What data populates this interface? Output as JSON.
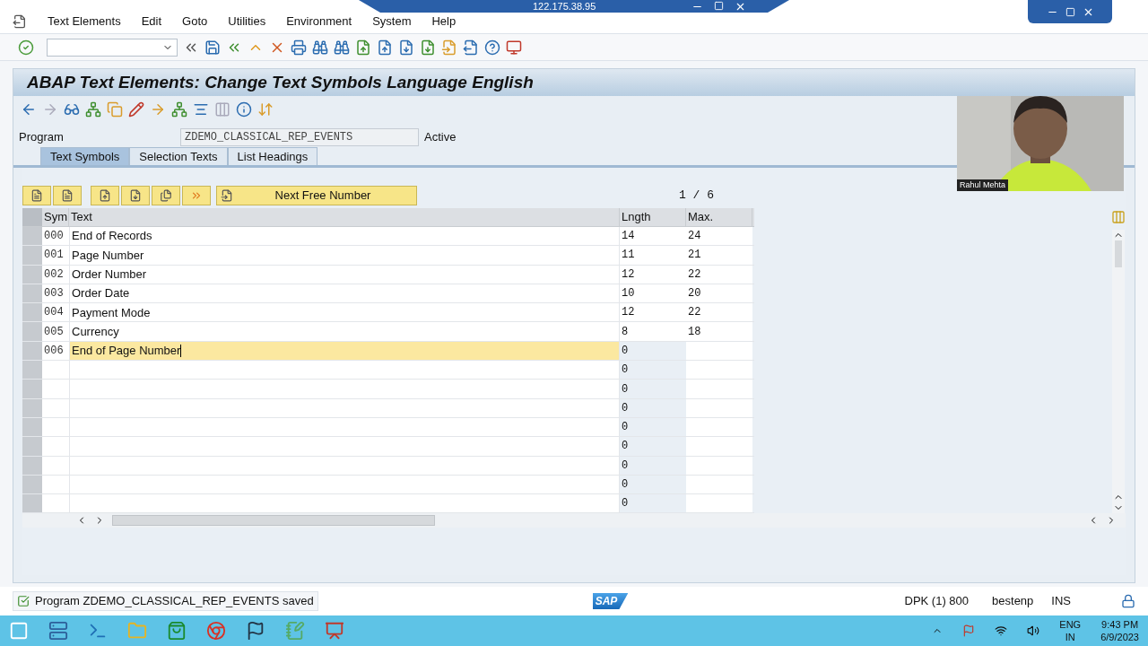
{
  "remote_bar": {
    "address": "122.175.38.95"
  },
  "menu": [
    "Text Elements",
    "Edit",
    "Goto",
    "Utilities",
    "Environment",
    "System",
    "Help"
  ],
  "title": "ABAP Text Elements: Change Text Symbols Language English",
  "program": {
    "label": "Program",
    "value": "ZDEMO_CLASSICAL_REP_EVENTS",
    "status": "Active"
  },
  "tabs": [
    {
      "label": "Text Symbols",
      "selected": true
    },
    {
      "label": "Selection Texts",
      "selected": false
    },
    {
      "label": "List Headings",
      "selected": false
    }
  ],
  "next_button": "Next Free Number",
  "page_count": "1 / 6",
  "table": {
    "columns": [
      "Sym",
      "Text",
      "Lngth",
      "Max."
    ],
    "rows": [
      {
        "sym": "000",
        "text": "End of Records",
        "length": "14",
        "max": "24",
        "editing": false
      },
      {
        "sym": "001",
        "text": "Page Number",
        "length": "11",
        "max": "21",
        "editing": false
      },
      {
        "sym": "002",
        "text": "Order Number",
        "length": "12",
        "max": "22",
        "editing": false
      },
      {
        "sym": "003",
        "text": "Order Date",
        "length": "10",
        "max": "20",
        "editing": false
      },
      {
        "sym": "004",
        "text": "Payment Mode",
        "length": "12",
        "max": "22",
        "editing": false
      },
      {
        "sym": "005",
        "text": "Currency",
        "length": "8",
        "max": "18",
        "editing": false
      },
      {
        "sym": "006",
        "text": "End of Page Number",
        "length": "0",
        "editing": true
      },
      {
        "length": "0",
        "editing": false
      },
      {
        "length": "0",
        "editing": false
      },
      {
        "length": "0",
        "editing": false
      },
      {
        "length": "0",
        "editing": false
      },
      {
        "length": "0",
        "editing": false
      },
      {
        "length": "0",
        "editing": false
      },
      {
        "length": "0",
        "editing": false
      },
      {
        "length": "0",
        "editing": false
      }
    ]
  },
  "webcam": {
    "name": "Rahul Mehta"
  },
  "status_bar": {
    "message": "Program ZDEMO_CLASSICAL_REP_EVENTS saved",
    "logo": "SAP",
    "system": "DPK (1) 800",
    "server": "bestenp",
    "mode": "INS"
  },
  "taskbar": {
    "language": "ENG",
    "region": "IN",
    "time": "9:43 PM",
    "date": "6/9/2023"
  }
}
